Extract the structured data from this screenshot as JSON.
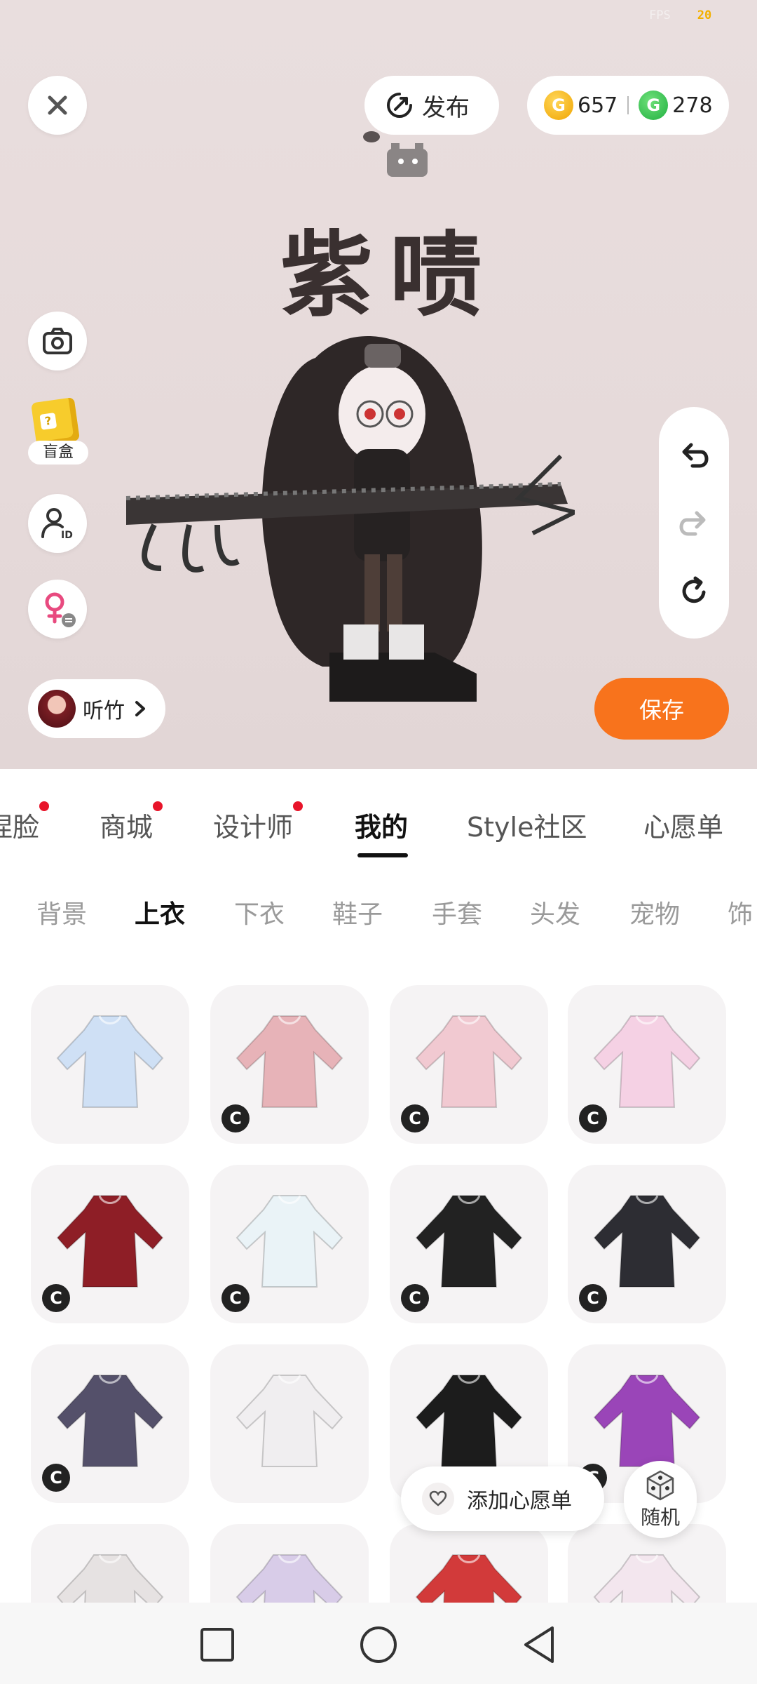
{
  "status": {
    "fps_label": "FPS",
    "fps_value": "20"
  },
  "header": {
    "publish_label": "发布",
    "gold_amount": "657",
    "green_amount": "278",
    "gold_symbol": "G",
    "green_symbol": "G"
  },
  "stage": {
    "character_title": "紫啧",
    "blind_box_label": "盲盒",
    "blind_box_mark": "?",
    "user_name": "听竹",
    "save_label": "保存"
  },
  "tabs": [
    {
      "label": "捏脸",
      "dot": true
    },
    {
      "label": "商城",
      "dot": true
    },
    {
      "label": "设计师",
      "dot": true
    },
    {
      "label": "我的",
      "dot": false,
      "active": true
    },
    {
      "label": "Style社区",
      "dot": false
    },
    {
      "label": "心愿单",
      "dot": false
    }
  ],
  "categories": [
    "背景",
    "上衣",
    "下衣",
    "鞋子",
    "手套",
    "头发",
    "宠物",
    "饰"
  ],
  "active_category": "上衣",
  "badge_letter": "C",
  "items": [
    {
      "name": "blue-lolita-dress",
      "badge": false,
      "color": "#cfe0f5"
    },
    {
      "name": "pink-ruffle-top",
      "badge": true,
      "color": "#e7b3b8"
    },
    {
      "name": "pink-bunny-hoodie",
      "badge": true,
      "color": "#f1c9d1"
    },
    {
      "name": "pink-butterfly-dress",
      "badge": true,
      "color": "#f5d1e4"
    },
    {
      "name": "red-riding-hood-dress",
      "badge": true,
      "color": "#8e1e26"
    },
    {
      "name": "white-sheer-top",
      "badge": true,
      "color": "#eaf3f7"
    },
    {
      "name": "black-maid-jacket",
      "badge": true,
      "color": "#222222"
    },
    {
      "name": "black-sailor-top",
      "badge": true,
      "color": "#2d2d33"
    },
    {
      "name": "striped-sleeve-dress",
      "badge": true,
      "color": "#54506a"
    },
    {
      "name": "white-bunny-hoodie",
      "badge": false,
      "color": "#f0eef0"
    },
    {
      "name": "black-corset-skirt",
      "badge": false,
      "color": "#1c1c1c"
    },
    {
      "name": "purple-cat-hoodie",
      "badge": true,
      "color": "#9a45b8"
    },
    {
      "name": "white-graphic-shirt",
      "badge": false,
      "color": "#e6e2e2"
    },
    {
      "name": "lavender-gown",
      "badge": false,
      "color": "#d8cce8"
    },
    {
      "name": "red-white-dress",
      "badge": false,
      "color": "#d23a3a"
    },
    {
      "name": "white-pink-blouse",
      "badge": false,
      "color": "#f3e6ee"
    }
  ],
  "floating": {
    "wishlist_label": "添加心愿单",
    "random_label": "随机"
  },
  "colors": {
    "accent": "#f8731c",
    "dot": "#e8142a"
  }
}
